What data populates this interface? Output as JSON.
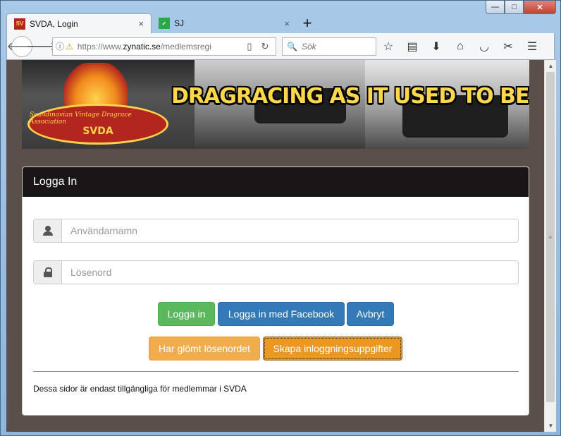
{
  "window": {
    "controls": {
      "minimize": "—",
      "maximize": "□",
      "close": "✕"
    }
  },
  "tabs": [
    {
      "favicon_text": "SV",
      "title": "SVDA, Login",
      "close": "×"
    },
    {
      "favicon_text": "✓",
      "title": "SJ",
      "close": "×"
    }
  ],
  "newtab_label": "+",
  "navbar": {
    "url_prefix": "https://www.",
    "url_domain": "zynatic.se",
    "url_rest": "/medlemsregi",
    "search_placeholder": "Sök"
  },
  "banner": {
    "slogan": "DRAGRACING AS IT USED TO BE!",
    "logo_script": "Scandinavian Vintage Dragrace Association",
    "logo_name": "SVDA"
  },
  "panel": {
    "heading": "Logga In",
    "username_placeholder": "Användarnamn",
    "password_placeholder": "Lösenord",
    "buttons": {
      "login": "Logga in",
      "login_facebook": "Logga in med Facebook",
      "cancel": "Avbryt",
      "forgot_password": "Har glömt lösenordet",
      "create_credentials": "Skapa inloggningsuppgifter"
    },
    "footer": "Dessa sidor är endast tillgängliga för medlemmar i SVDA"
  },
  "colors": {
    "page_background": "#5b4f4c",
    "panel_heading": "#1a1617",
    "success": "#5cb85c",
    "primary": "#337ab7",
    "warning": "#f0ad4e"
  }
}
